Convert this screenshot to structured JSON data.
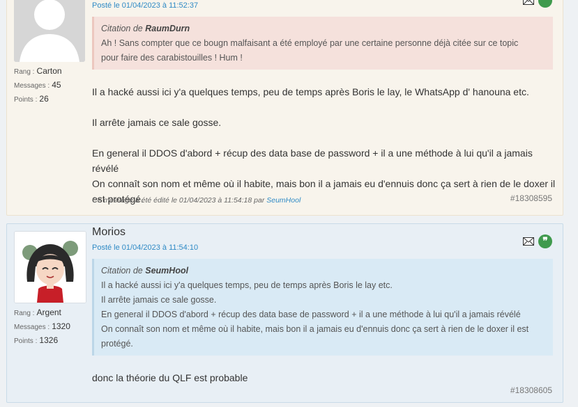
{
  "posts": [
    {
      "date": "Posté le 01/04/2023 à 11:52:37",
      "rank_label": "Rang :",
      "rank": "Carton",
      "messages_label": "Messages :",
      "messages": "45",
      "points_label": "Points :",
      "points": "26",
      "quote": {
        "cite_prefix": "Citation de",
        "cite_author": "RaumDurn",
        "lines": [
          "Ah ! Sans compter que ce bougn malfaisant a été employé par une certaine personne déjà citée sur ce topic",
          "pour faire des carabistouilles ! Hum !"
        ]
      },
      "body": {
        "p1": "Il a hacké aussi ici y'a quelques temps, peu de temps après Boris le lay, le WhatsApp d' hanouna etc.",
        "p2": "Il arrête jamais ce sale gosse.",
        "p3a": "En general il DDOS d'abord + récup des data base de password + il a une méthode à lui qu'il a jamais révélé",
        "p3b": "On connaît son nom et même où il habite, mais bon il a jamais eu d'ennuis donc ça sert à rien de le doxer il est protégé."
      },
      "edit_note": "Ce message a été édité le 01/04/2023 à 11:54:18 par",
      "edit_by": "SeumHool",
      "post_id": "#18308595"
    },
    {
      "author": "Morios",
      "date": "Posté le 01/04/2023 à 11:54:10",
      "rank_label": "Rang :",
      "rank": "Argent",
      "messages_label": "Messages :",
      "messages": "1320",
      "points_label": "Points :",
      "points": "1326",
      "quote": {
        "cite_prefix": "Citation de",
        "cite_author": "SeumHool",
        "lines": [
          "Il a hacké aussi ici y'a quelques temps, peu de temps après Boris le lay etc.",
          "Il arrête jamais ce sale gosse.",
          "En general il DDOS d'abord + récup des data base de password + il a une méthode à lui qu'il a jamais révélé",
          "On connaît son nom et même où il habite, mais bon il a jamais eu d'ennuis donc ça sert à rien de le doxer il est protégé."
        ]
      },
      "body": {
        "p1": "donc la théorie du QLF est probable"
      },
      "post_id": "#18308605"
    }
  ],
  "icons": {
    "mail": "mail-icon",
    "quote": "quote-icon"
  },
  "colors": {
    "link": "#2f8ac5",
    "quote_button": "#3f9a4d",
    "post1_bg": "#f8f4ec",
    "post2_bg": "#e8eff5"
  }
}
